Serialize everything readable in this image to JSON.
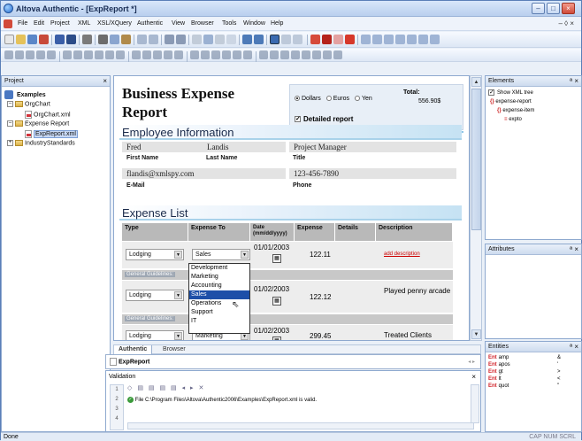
{
  "window": {
    "title": "Altova Authentic - [ExpReport *]",
    "min_label": "–",
    "max_label": "□",
    "close_label": "×"
  },
  "menu": {
    "items": [
      "File",
      "Edit",
      "Project",
      "XML",
      "XSL/XQuery",
      "Authentic",
      "View",
      "Browser",
      "Tools",
      "Window",
      "Help"
    ],
    "mdi_controls": "– ◊ ×"
  },
  "project": {
    "title": "Project",
    "close": "×",
    "tree": [
      {
        "label": "Examples",
        "level": 0,
        "kind": "root"
      },
      {
        "label": "OrgChart",
        "level": 1,
        "kind": "folder",
        "exp": "–"
      },
      {
        "label": "OrgChart.xml",
        "level": 2,
        "kind": "doc"
      },
      {
        "label": "Expense Report",
        "level": 1,
        "kind": "folder",
        "exp": "–"
      },
      {
        "label": "ExpReport.xml",
        "level": 2,
        "kind": "doc",
        "selected": true
      },
      {
        "label": "IndustryStandards",
        "level": 1,
        "kind": "folder",
        "exp": "+"
      }
    ]
  },
  "doc": {
    "title_line1": "Business Expense",
    "title_line2": "Report",
    "currency": {
      "options": [
        "Dollars",
        "Euros",
        "Yen"
      ],
      "selected": "Dollars"
    },
    "total": {
      "label": "Total:",
      "value": "556.90$"
    },
    "detailed": {
      "label": "Detailed report",
      "checked": true
    },
    "employee": {
      "heading": "Employee Information",
      "first_name": "Fred",
      "last_name": "Landis",
      "title": "Project Manager",
      "email": "flandis@xmlspy.com",
      "phone": "123-456-7890",
      "labels": {
        "first": "First Name",
        "last": "Last Name",
        "title": "Title",
        "email": "E-Mail",
        "phone": "Phone"
      }
    },
    "expense": {
      "heading": "Expense List",
      "columns": [
        "Type",
        "Expense To",
        "Date\n(mm/dd/yyyy)",
        "Expense",
        "Details",
        "Description"
      ],
      "rows": [
        {
          "type": "Lodging",
          "to": "Sales",
          "date": "01/01/2003",
          "expense": "122.11",
          "details": "",
          "description": "add description"
        },
        {
          "type": "Lodging",
          "to": "Sales",
          "date": "01/02/2003",
          "expense": "122.12",
          "details": "",
          "description": "Played penny arcade"
        },
        {
          "type": "Lodging",
          "to": "Marketing",
          "date": "01/02/2003",
          "expense": "299.45",
          "details": "",
          "description": "Treated Clients"
        }
      ],
      "guidelines_label": "General Guidelines:",
      "dropdown_options": [
        "Development",
        "Marketing",
        "Accounting",
        "Sales",
        "Operations",
        "Support",
        "IT"
      ],
      "dropdown_highlight": "Sales"
    }
  },
  "elements": {
    "title": "Elements",
    "show_xml_tree": "Show XML tree",
    "items": [
      "expense-report",
      "expense-item",
      "expto"
    ]
  },
  "attributes": {
    "title": "Attributes"
  },
  "entities": {
    "title": "Entities",
    "items": [
      {
        "name": "amp",
        "value": "&"
      },
      {
        "name": "apos",
        "value": "'"
      },
      {
        "name": "gt",
        "value": ">"
      },
      {
        "name": "lt",
        "value": "<"
      },
      {
        "name": "quot",
        "value": "\""
      }
    ]
  },
  "tabs": {
    "authentic": "Authentic",
    "browser": "Browser",
    "file": "ExpReport"
  },
  "validation": {
    "title": "Validation",
    "message": "File C:\\Program Files\\Altova\\Authentic2006\\Examples\\ExpReport.xml is valid."
  },
  "status": {
    "left": "Done",
    "right": "CAP  NUM  SCRL"
  }
}
